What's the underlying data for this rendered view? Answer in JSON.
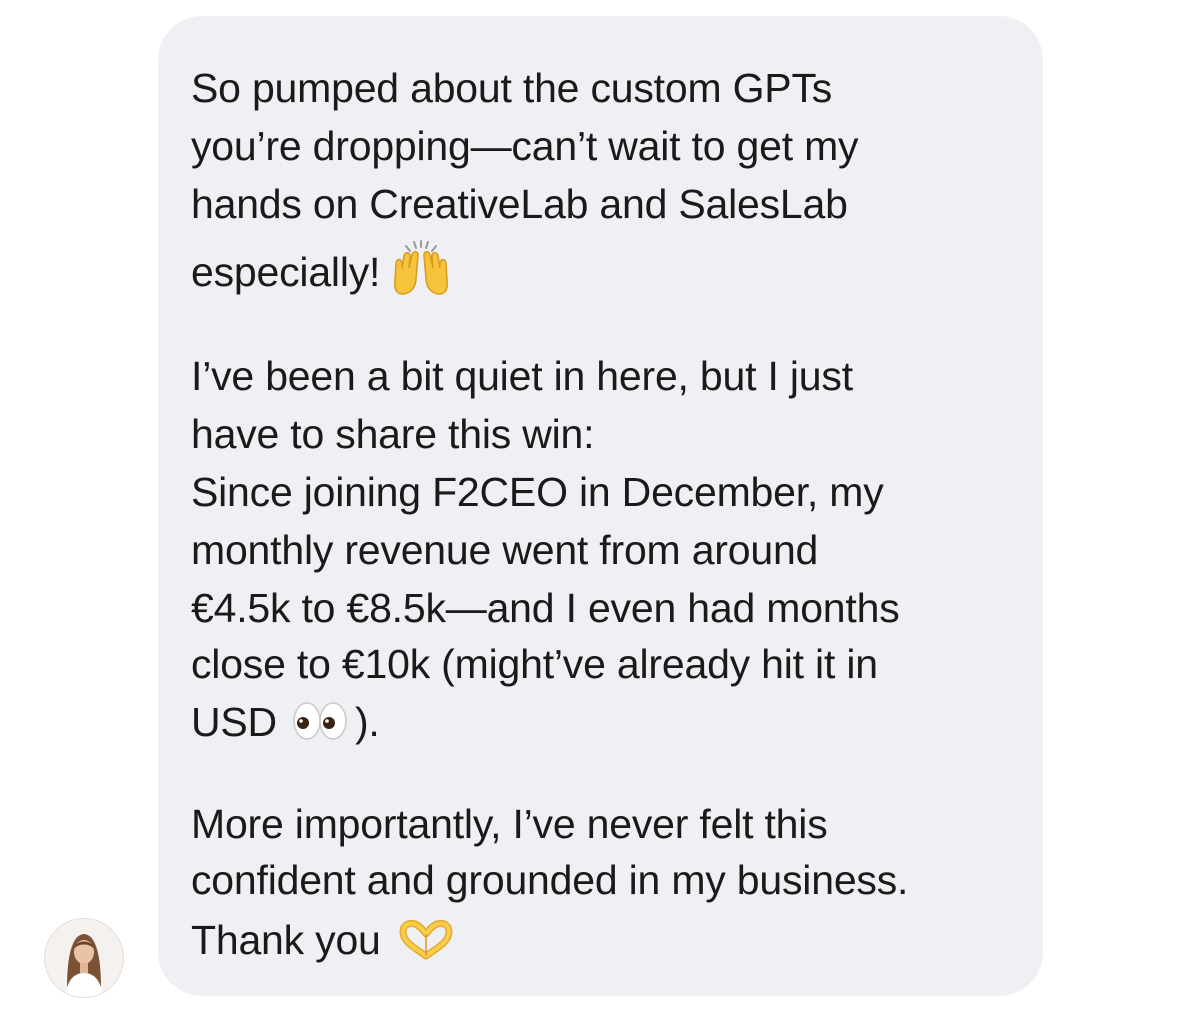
{
  "message": {
    "paragraph1": [
      "So pumped about the custom GPTs",
      "you’re dropping—can’t wait to get my",
      "hands on CreativeLab and SalesLab",
      "especially!"
    ],
    "paragraph2": [
      "I’ve been a bit quiet in here, but I just",
      "have to share this win:",
      "Since joining F2CEO in December, my",
      "monthly revenue went from around",
      "€4.5k to €8.5k—and I even had months",
      "close to €10k (might’ve already hit it in",
      "USD",
      ")."
    ],
    "paragraph3": [
      "More importantly, I’ve never felt this",
      "confident and grounded in my business.",
      "Thank you"
    ],
    "emojis": {
      "celebrate": "raising-hands-icon",
      "eyes": "eyes-icon",
      "heart": "heart-hands-icon"
    }
  },
  "colors": {
    "bubble": "#eff0f3",
    "text": "#1a1a1a",
    "emoji": "#f5c43a"
  }
}
